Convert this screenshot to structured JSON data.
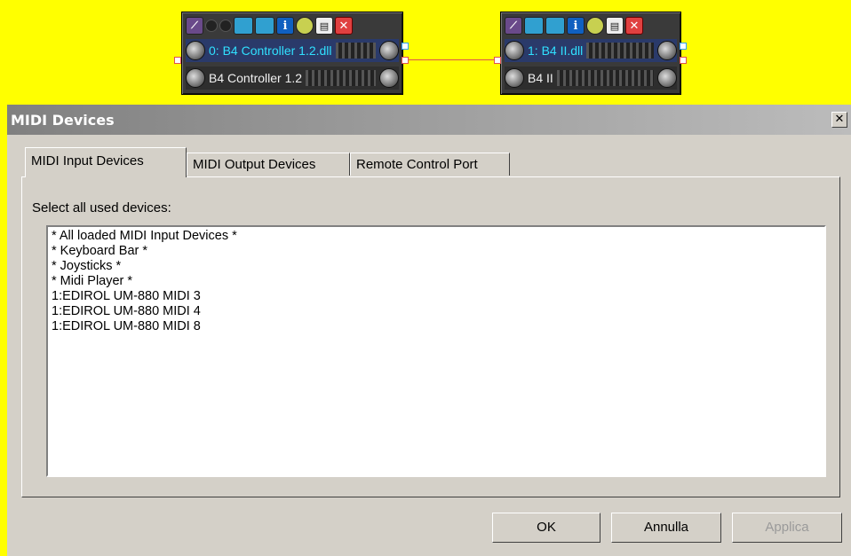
{
  "rack": {
    "modules": [
      {
        "title": "0: B4 Controller 1.2.dll",
        "subtitle": "B4 Controller 1.2"
      },
      {
        "title": "1: B4 II.dll",
        "subtitle": "B4 II"
      }
    ],
    "toolbar_info_glyph": "i",
    "toolbar_close_glyph": "✕"
  },
  "dialog": {
    "title": "MIDI Devices",
    "close_glyph": "✕",
    "tabs": [
      {
        "label": "MIDI Input Devices",
        "active": true
      },
      {
        "label": "MIDI Output Devices",
        "active": false
      },
      {
        "label": "Remote Control Port",
        "active": false
      }
    ],
    "prompt": "Select all used devices:",
    "devices": [
      "* All loaded MIDI Input Devices *",
      "* Keyboard Bar *",
      "* Joysticks *",
      "* Midi Player *",
      "1:EDIROL UM-880 MIDI 3",
      "1:EDIROL UM-880 MIDI 4",
      "1:EDIROL UM-880 MIDI 8"
    ],
    "buttons": {
      "ok": "OK",
      "cancel": "Annulla",
      "apply": "Applica"
    }
  },
  "colors": {
    "rack_background": "#ffff00",
    "module_label_primary": "#30e0ff",
    "wire": "#e05050"
  }
}
